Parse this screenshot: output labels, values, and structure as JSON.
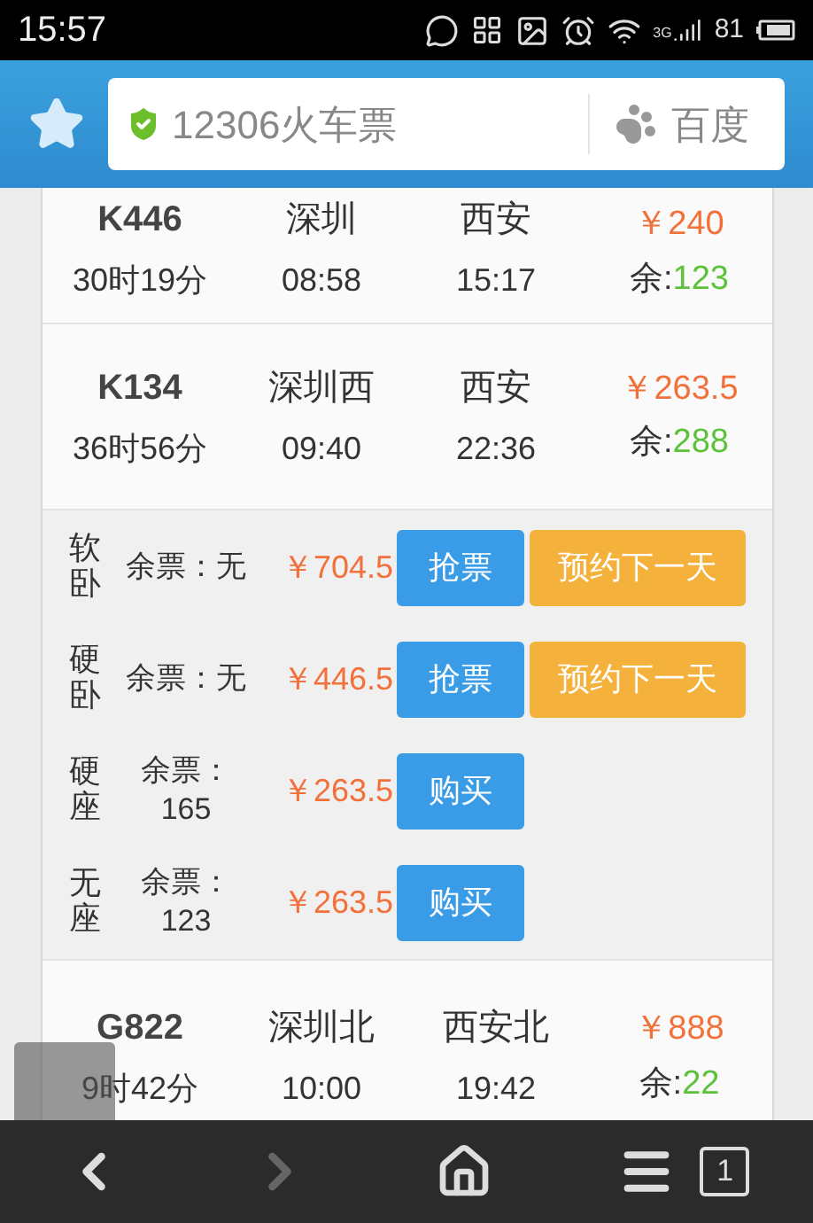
{
  "status_bar": {
    "time": "15:57",
    "network": "3G",
    "battery": "81"
  },
  "address_bar": {
    "title": "12306火车票",
    "search_engine": "百度"
  },
  "trains": [
    {
      "number": "K446",
      "duration": "30时19分",
      "from": "深圳",
      "depart": "08:58",
      "to": "西安",
      "arrive": "15:17",
      "price": "￥240",
      "remaining_label": "余:",
      "remaining": "123"
    },
    {
      "number": "K134",
      "duration": "36时56分",
      "from": "深圳西",
      "depart": "09:40",
      "to": "西安",
      "arrive": "22:36",
      "price": "￥263.5",
      "remaining_label": "余:",
      "remaining": "288",
      "seats": [
        {
          "name": "软卧",
          "remaining_lines": [
            "余票：无"
          ],
          "price": "￥704.5",
          "buttons": [
            {
              "label": "抢票",
              "kind": "primary"
            },
            {
              "label": "预约下一天",
              "kind": "reserve"
            }
          ]
        },
        {
          "name": "硬卧",
          "remaining_lines": [
            "余票：无"
          ],
          "price": "￥446.5",
          "buttons": [
            {
              "label": "抢票",
              "kind": "primary"
            },
            {
              "label": "预约下一天",
              "kind": "reserve"
            }
          ]
        },
        {
          "name": "硬座",
          "remaining_lines": [
            "余票：",
            "165"
          ],
          "price": "￥263.5",
          "buttons": [
            {
              "label": "购买",
              "kind": "primary"
            }
          ]
        },
        {
          "name": "无座",
          "remaining_lines": [
            "余票：",
            "123"
          ],
          "price": "￥263.5",
          "buttons": [
            {
              "label": "购买",
              "kind": "primary"
            }
          ]
        }
      ]
    },
    {
      "number": "G822",
      "duration": "9时42分",
      "from": "深圳北",
      "depart": "10:00",
      "to": "西安北",
      "arrive": "19:42",
      "price": "￥888",
      "remaining_label": "余:",
      "remaining": "22"
    }
  ],
  "bottom_bar": {
    "forward_disabled": true,
    "tab_count": "1"
  }
}
